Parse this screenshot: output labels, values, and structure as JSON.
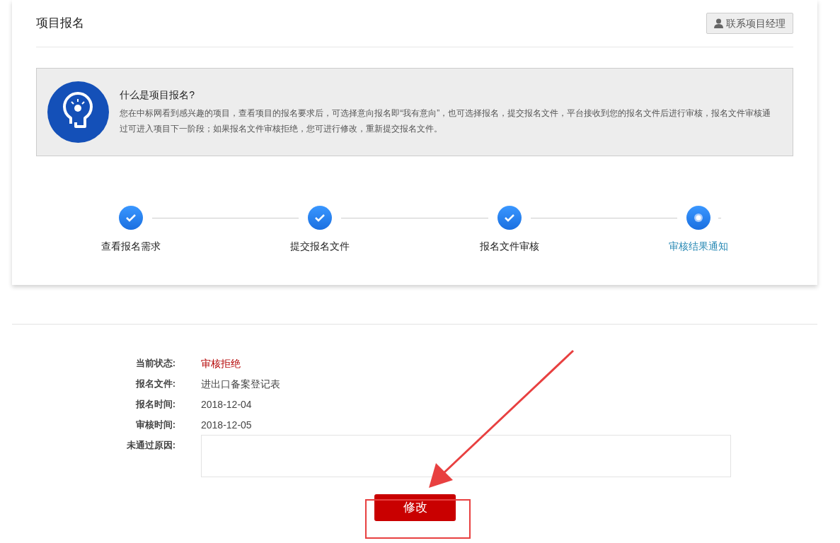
{
  "header": {
    "title": "项目报名",
    "contact_button": "联系项目经理"
  },
  "info": {
    "title": "什么是项目报名?",
    "description": "您在中标网看到感兴趣的项目，查看项目的报名要求后，可选择意向报名即“我有意向”，也可选择报名，提交报名文件，平台接收到您的报名文件后进行审核，报名文件审核通过可进入项目下一阶段；如果报名文件审核拒绝，您可进行修改，重新提交报名文件。"
  },
  "steps": [
    {
      "label": "查看报名需求",
      "kind": "done"
    },
    {
      "label": "提交报名文件",
      "kind": "done"
    },
    {
      "label": "报名文件审核",
      "kind": "done"
    },
    {
      "label": "审核结果通知",
      "kind": "current"
    }
  ],
  "details": [
    {
      "label": "当前状态:",
      "value": "审核拒绝",
      "kind": "status"
    },
    {
      "label": "报名文件:",
      "value": "进出口备案登记表",
      "kind": "text"
    },
    {
      "label": "报名时间:",
      "value": "2018-12-04",
      "kind": "text"
    },
    {
      "label": "审核时间:",
      "value": "2018-12-05",
      "kind": "text"
    },
    {
      "label": "未通过原因:",
      "kind": "textarea"
    }
  ],
  "edit_button": "修改"
}
